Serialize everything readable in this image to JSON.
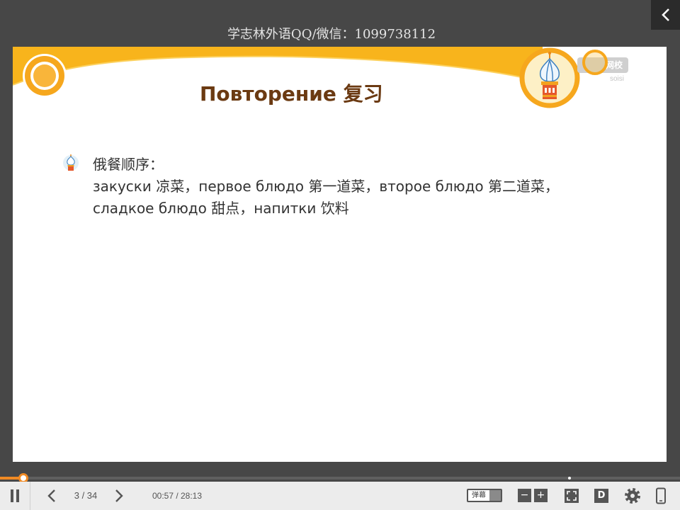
{
  "colors": {
    "accent": "#f6a71d",
    "title": "#6b3a12",
    "page_background": "#474747",
    "control_bar": "#ececec",
    "progress": "#f08a24"
  },
  "watermark": "学志林外语QQ/微信：1099738112",
  "back_button": {
    "icon": "chevron-left-icon"
  },
  "slide": {
    "decor_icons": [
      "ring-icon",
      "onion-dome-icon"
    ],
    "logo": {
      "text": "网校",
      "sub": "soisi"
    },
    "title": "Повторение 复习",
    "content": {
      "bullet_icon": "onion-dome-icon",
      "heading": "俄餐顺序：",
      "lines": [
        "закуски 凉菜，первое блюдо 第一道菜，второе блюдо 第二道菜，",
        "сладкое блюдо 甜点，напитки 饮料"
      ]
    }
  },
  "player": {
    "progress": 0.034,
    "page": "3 / 34",
    "time": "00:57 / 28:13",
    "danmaku_label": "弹幕",
    "zoom_out_label": "−",
    "zoom_in_label": "+",
    "d_label": "D",
    "icons": {
      "play_pause": "pause-icon",
      "prev": "chevron-left-icon",
      "next": "chevron-right-icon",
      "fullscreen": "fullscreen-icon",
      "settings": "gear-icon",
      "mobile": "phone-icon"
    }
  }
}
